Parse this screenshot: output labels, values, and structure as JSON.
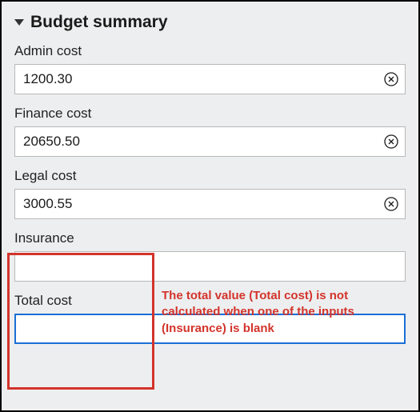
{
  "header": {
    "title": "Budget summary"
  },
  "fields": {
    "admin": {
      "label": "Admin cost",
      "value": "1200.30"
    },
    "finance": {
      "label": "Finance cost",
      "value": "20650.50"
    },
    "legal": {
      "label": "Legal cost",
      "value": "3000.55"
    },
    "insurance": {
      "label": "Insurance",
      "value": ""
    },
    "total": {
      "label": "Total cost",
      "value": ""
    }
  },
  "annotation": {
    "text": "The total value (Total cost) is not calculated when one of the inputs (Insurance) is blank"
  },
  "colors": {
    "annotation": "#d3342b",
    "focus": "#1a6fd6"
  }
}
